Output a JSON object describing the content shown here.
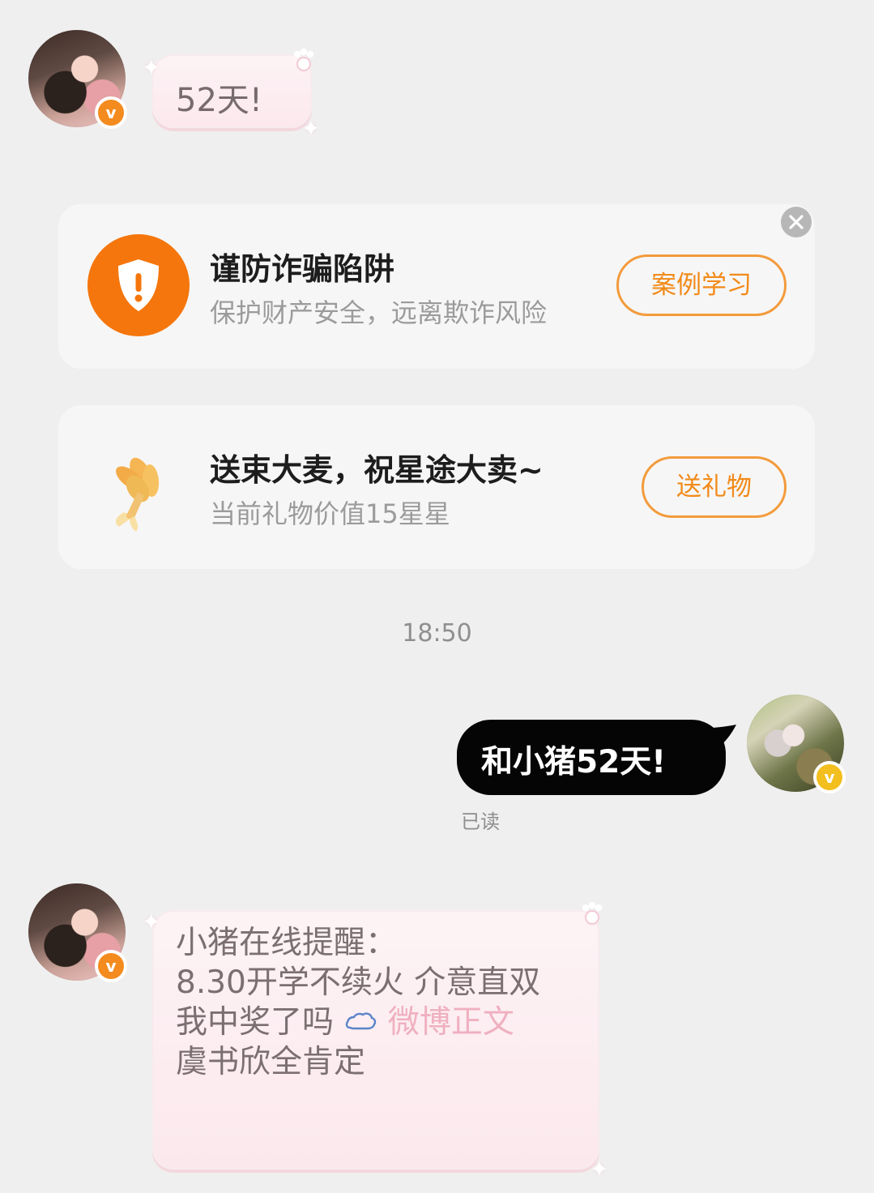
{
  "messages": {
    "first_bubble": {
      "text": "52天!"
    },
    "anti_fraud": {
      "title": "谨防诈骗陷阱",
      "subtitle": "保护财产安全，远离欺诈风险",
      "button_label": "案例学习"
    },
    "gift": {
      "title": "送束大麦，祝星途大卖~",
      "subtitle": "当前礼物价值15星星",
      "button_label": "送礼物"
    },
    "timestamp": "18:50",
    "outgoing_message": {
      "text": "和小猪52天!",
      "status": "已读"
    },
    "reminder": {
      "line1": "小猪在线提醒：",
      "line2": "8.30开学不续火 介意直双",
      "line3_prefix": "我中奖了吗",
      "line3_link": "微博正文",
      "line4": "虞书欣全肯定"
    }
  },
  "icons": {
    "shield": "shield-icon",
    "close": "close-icon",
    "bouquet": "wheat-bouquet-icon",
    "weibo": "weibo-icon"
  },
  "colors": {
    "background": "#efefef",
    "card": "#f6f6f6",
    "orange": "#f28a18",
    "pink_bubble": "#fbe8ed",
    "black_bubble": "#050505",
    "link_pink": "#efb0c1"
  }
}
